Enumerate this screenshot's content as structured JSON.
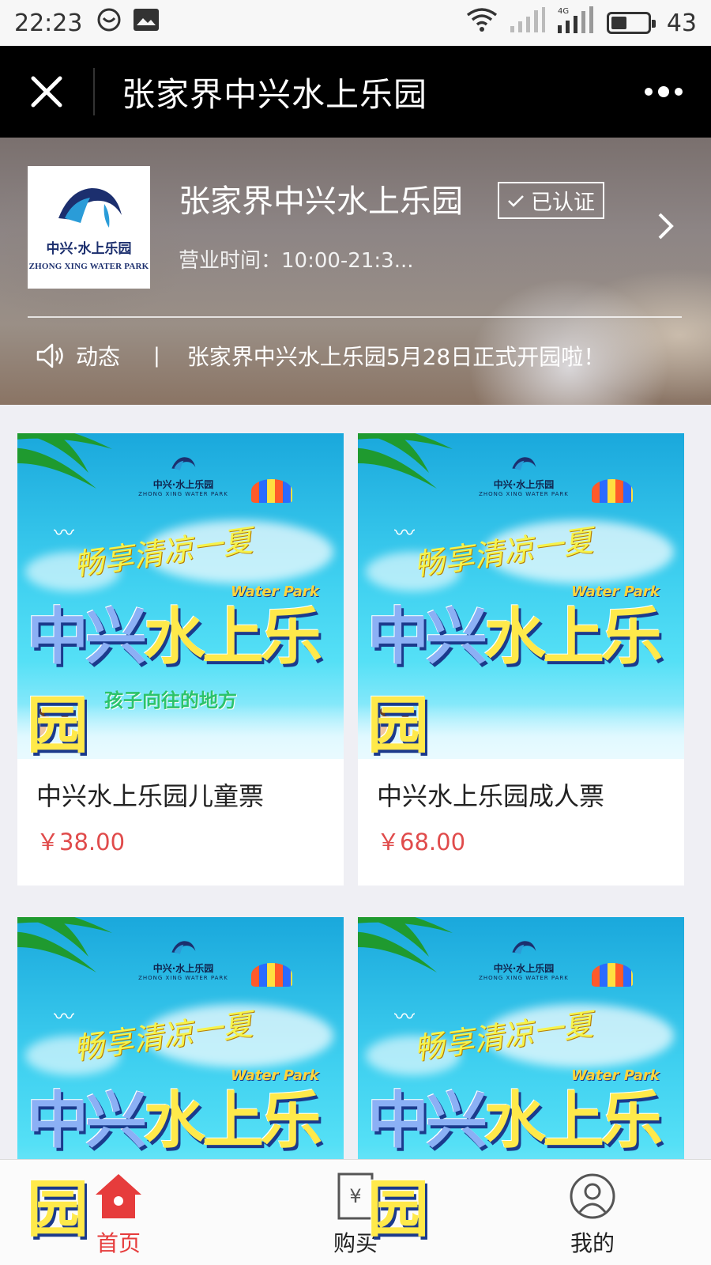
{
  "status_bar": {
    "time": "22:23",
    "battery": "43",
    "network": "4G"
  },
  "nav": {
    "title": "张家界中兴水上乐园",
    "close_icon": "close-icon",
    "more_icon": "more-icon"
  },
  "shop": {
    "logo_cn": "中兴·水上乐园",
    "logo_en": "ZHONG XING WATER PARK",
    "name": "张家界中兴水上乐园",
    "verified_label": "已认证",
    "hours": "营业时间：10:00-21:3..."
  },
  "news": {
    "label": "动态",
    "separator": "|",
    "text": "张家界中兴水上乐园5月28日正式开园啦！"
  },
  "poster": {
    "logo_cn": "中兴·水上乐园",
    "logo_en": "ZHONG XING WATER PARK",
    "slogan": "畅享清凉一夏",
    "title_a": "中兴",
    "title_b": "水上乐园",
    "water_park": "Water Park",
    "sub_kids": "孩子向往的地方"
  },
  "products": [
    {
      "name": "中兴水上乐园儿童票",
      "price": "￥38.00"
    },
    {
      "name": "中兴水上乐园成人票",
      "price": "￥68.00"
    },
    {
      "name": "",
      "price": ""
    },
    {
      "name": "",
      "price": ""
    }
  ],
  "tabbar": {
    "home": "首页",
    "buy": "购买",
    "mine": "我的"
  },
  "colors": {
    "accent_red": "#e63c3c",
    "price_red": "#e04b4b",
    "nav_black": "#000000"
  }
}
